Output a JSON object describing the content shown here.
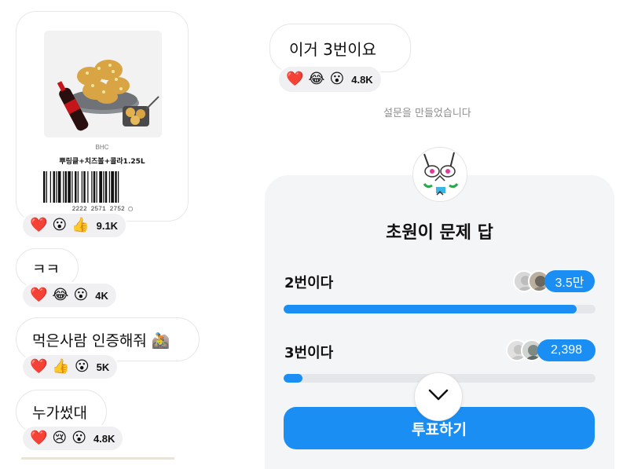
{
  "left_thread": {
    "product_card": {
      "brand": "BHC",
      "name": "뿌링클+치즈볼+콜라1.25L",
      "barcode_number": "2222 2571 2752 ▢",
      "reactions": [
        "❤️",
        "😮",
        "👍"
      ],
      "reaction_count": "9.1K"
    },
    "messages": [
      {
        "text": "ㅋㅋ",
        "reactions": [
          "❤️",
          "😂",
          "😮"
        ],
        "count": "4K"
      },
      {
        "text": "먹은사람 인증해줘 🚵",
        "reactions": [
          "❤️",
          "👍",
          "😮"
        ],
        "count": "5K"
      },
      {
        "text": "누가썼대",
        "reactions": [
          "❤️",
          "😢",
          "😮"
        ],
        "count": "4.8K"
      }
    ]
  },
  "right_thread": {
    "message": {
      "text": "이거 3번이요",
      "reactions": [
        "❤️",
        "😂",
        "😮"
      ],
      "count": "4.8K"
    },
    "system_notice": "설문을 만들었습니다",
    "poll": {
      "title": "초원이 문제 답",
      "options": [
        {
          "label": "2번이다",
          "count_label": "3.5만",
          "share": 0.94
        },
        {
          "label": "3번이다",
          "count_label": "2,398",
          "share": 0.06
        }
      ],
      "vote_button_label": "투표하기"
    }
  },
  "colors": {
    "accent": "#1a8ef2",
    "reaction_bg": "#f0f0f2",
    "bubble_border": "#e6e6e6",
    "poll_bg": "#f4f5f7"
  }
}
